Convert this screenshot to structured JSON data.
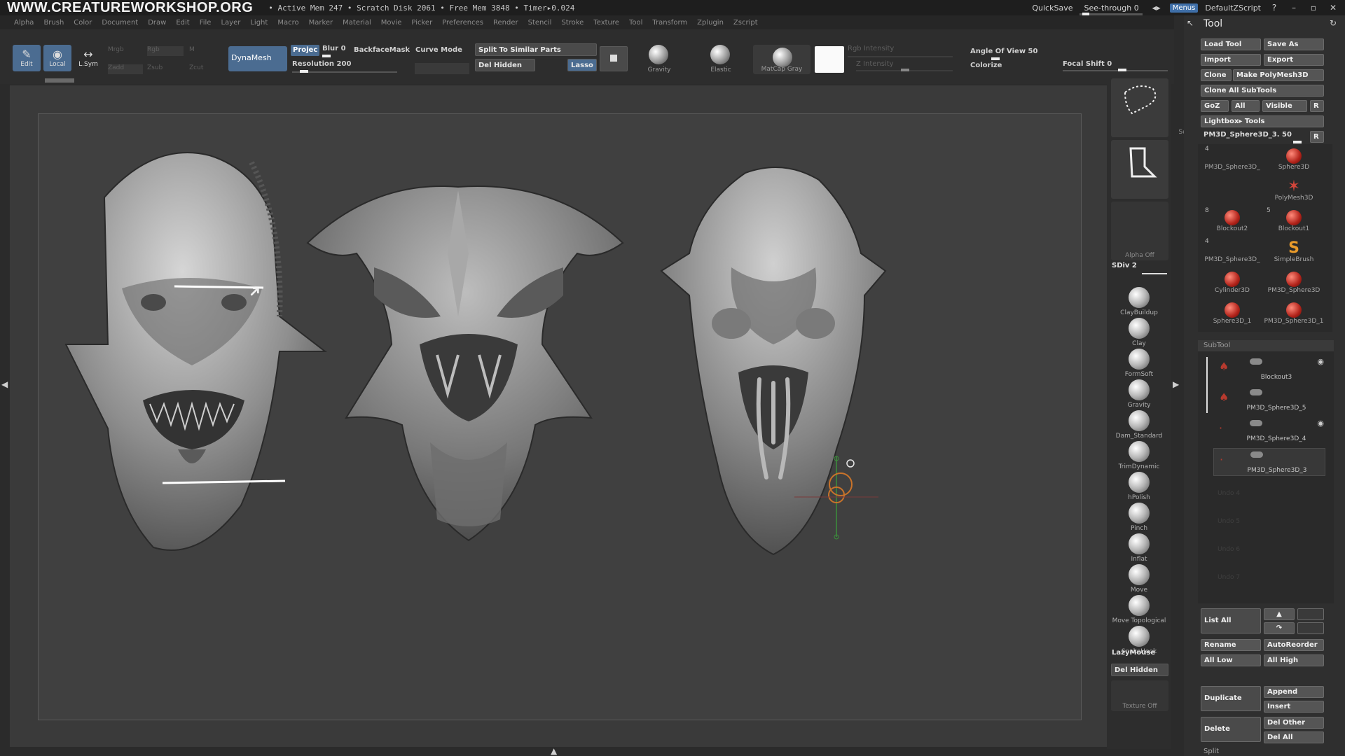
{
  "titlebar": {
    "brand": "WWW.CREATUREWORKSHOP.ORG",
    "stats": "• Active Mem 247 • Scratch Disk 2061 • Free Mem 3848 • Timer▸0.024",
    "quicksave": "QuickSave",
    "seethrough": "See-through  0",
    "menus": "Menus",
    "script": "DefaultZScript"
  },
  "menubar": [
    "Alpha",
    "Brush",
    "Color",
    "Document",
    "Draw",
    "Edit",
    "File",
    "Layer",
    "Light",
    "Macro",
    "Marker",
    "Material",
    "Movie",
    "Picker",
    "Preferences",
    "Render",
    "Stencil",
    "Stroke",
    "Texture",
    "Tool",
    "Transform",
    "Zplugin",
    "Zscript"
  ],
  "shelf": {
    "edit": "Edit",
    "local": "Local",
    "lsym": "L.Sym",
    "mrgb": "Mrgb",
    "rgb": "Rgb",
    "m": "M",
    "zadd": "Zadd",
    "zsub": "Zsub",
    "zcut": "Zcut",
    "dynamesh": "DynaMesh",
    "projec": "Projec",
    "blur": "Blur 0",
    "resolution": "Resolution 200",
    "backfacemask": "BackfaceMask",
    "curvemode": "Curve Mode",
    "split_similar": "Split To Similar Parts",
    "del_hidden": "Del Hidden",
    "lasso": "Lasso",
    "gravity": "Gravity",
    "elastic": "Elastic",
    "matcap": "MatCap Gray",
    "rgb_intensity": "Rgb Intensity",
    "z_intensity": "Z Intensity",
    "angle_of_view": "Angle Of View 50",
    "colorize": "Colorize",
    "focal_shift": "Focal Shift 0"
  },
  "brushcol": {
    "selectlasso": "SelectLasso",
    "lasso": "Lasso",
    "alpha": "Alpha Off",
    "sdiv": "SDiv 2",
    "brushes": [
      "ClayBuildup",
      "Clay",
      "FormSoft",
      "Gravity",
      "Dam_Standard",
      "TrimDynamic",
      "hPolish",
      "Pinch",
      "Inflat",
      "Move",
      "Move Topological",
      "SnakeHook"
    ],
    "lazymouse": "LazyMouse",
    "del_hidden": "Del Hidden",
    "texture": "Texture Off"
  },
  "toolpanel": {
    "title": "Tool",
    "load_tool": "Load Tool",
    "save_as": "Save As",
    "import": "Import",
    "export": "Export",
    "clone": "Clone",
    "make_polymesh": "Make PolyMesh3D",
    "clone_all": "Clone All SubTools",
    "goz": "GoZ",
    "all": "All",
    "visible": "Visible",
    "r": "R",
    "lightbox_tools": "Lightbox▸ Tools",
    "current_tool": "PM3D_Sphere3D_3. 50",
    "tools": [
      {
        "name": "PM3D_Sphere3D_",
        "count": "4"
      },
      {
        "name": "Sphere3D",
        "count": ""
      },
      {
        "name": "PolyMesh3D",
        "count": ""
      },
      {
        "name": "Blockout2",
        "count": "8"
      },
      {
        "name": "Blockout1",
        "count": "5"
      },
      {
        "name": "PM3D_Sphere3D_",
        "count": "4"
      },
      {
        "name": "SimpleBrush",
        "count": ""
      },
      {
        "name": "Cylinder3D",
        "count": ""
      },
      {
        "name": "PM3D_Sphere3D",
        "count": ""
      },
      {
        "name": "Sphere3D_1",
        "count": ""
      },
      {
        "name": "PM3D_Sphere3D_1",
        "count": ""
      }
    ],
    "subtool_header": "SubTool",
    "subtools": [
      "Blockout3",
      "PM3D_Sphere3D_5",
      "PM3D_Sphere3D_4",
      "PM3D_Sphere3D_3"
    ],
    "undo_lines": [
      "Undo 4",
      "Undo 5",
      "Undo 6",
      "Undo 7"
    ],
    "list_all": "List All",
    "rename": "Rename",
    "autoreorder": "AutoReorder",
    "all_low": "All Low",
    "all_high": "All High",
    "duplicate": "Duplicate",
    "append": "Append",
    "insert": "Insert",
    "delete": "Delete",
    "del_other": "Del Other",
    "del_all": "Del All",
    "split": "Split"
  }
}
